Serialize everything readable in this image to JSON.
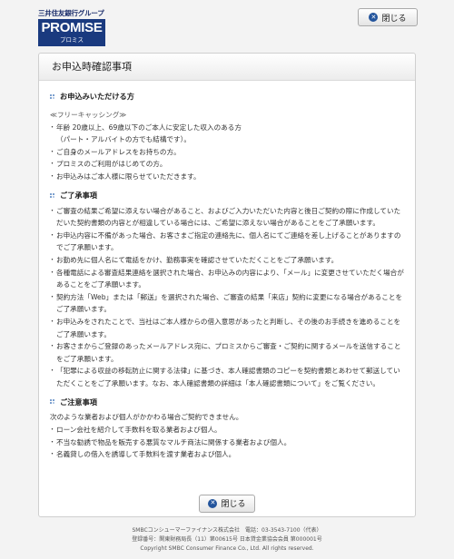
{
  "logo": {
    "group": "三井住友銀行グループ",
    "brand": "PROMISE",
    "brand_sub": "プロミス"
  },
  "close_top_label": "閉じる",
  "close_bottom_label": "閉じる",
  "close_icon": "close-icon",
  "panel_title": "お申込時確認事項",
  "sections": {
    "eligible": {
      "title": "お申込みいただける方",
      "subheading": "≪フリーキャッシング≫",
      "items": [
        "年齢 20歳以上、69歳以下のご本人に安定した収入のある方\n（パート・アルバイトの方でも結構です）。",
        "ご自身のメールアドレスをお持ちの方。",
        "プロミスのご利用がはじめての方。",
        "お申込みはご本人様に限らせていただきます。"
      ]
    },
    "consent": {
      "title": "ご了承事項",
      "items": [
        "ご審査の結果ご希望に添えない場合があること、およびご入力いただいた内容と後日ご契約の際に作成していただいた契約書類の内容とが相違している場合には、ご希望に添えない場合があることをご了承願います。",
        "お申込内容に不備があった場合、お客さまご指定の連絡先に、個人名にてご連絡を差し上げることがありますのでご了承願います。",
        "お勤め先に個人名にて電話をかけ、勤務事実を確認させていただくことをご了承願います。",
        "各種電話による審査結果連絡を選択された場合、お申込みの内容により、「メール」に変更させていただく場合があることをご了承願います。",
        "契約方法「Web」または「郵送」を選択された場合、ご審査の結果「来店」契約に変更になる場合があることをご了承願います。",
        "お申込みをされたことで、当社はご本人様からの借入意思があったと判断し、その後のお手続きを進めることをご了承願います。",
        "お客さまからご登録のあったメールアドレス宛に、プロミスからご審査・ご契約に関するメールを送信することをご了承願います。",
        "「犯罪による収益の移転防止に関する法律」に基づき、本人確認書類のコピーを契約書類とあわせて郵送していただくことをご了承願います。なお、本人確認書類の詳細は「本人確認書類について」をご覧ください。"
      ]
    },
    "notice": {
      "title": "ご注意事項",
      "intro": "次のような業者および個人がかかわる場合ご契約できません。",
      "items": [
        "ローン会社を紹介して手数料を取る業者および個人。",
        "不当な勧誘で物品を販売する悪質なマルチ商法に関係する業者および個人。",
        "名義貸しの借入を誘導して手数料を渡す業者および個人。"
      ]
    }
  },
  "footer": {
    "line1": "SMBCコンシューマーファイナンス株式会社　電話：03-3543-7100（代表）",
    "line2": "登録番号：関東財務局長（11）第00615号 日本貸金業協会会員 第000001号",
    "line3": "Copyright SMBC Consumer Finance Co., Ltd. All rights reserved."
  }
}
